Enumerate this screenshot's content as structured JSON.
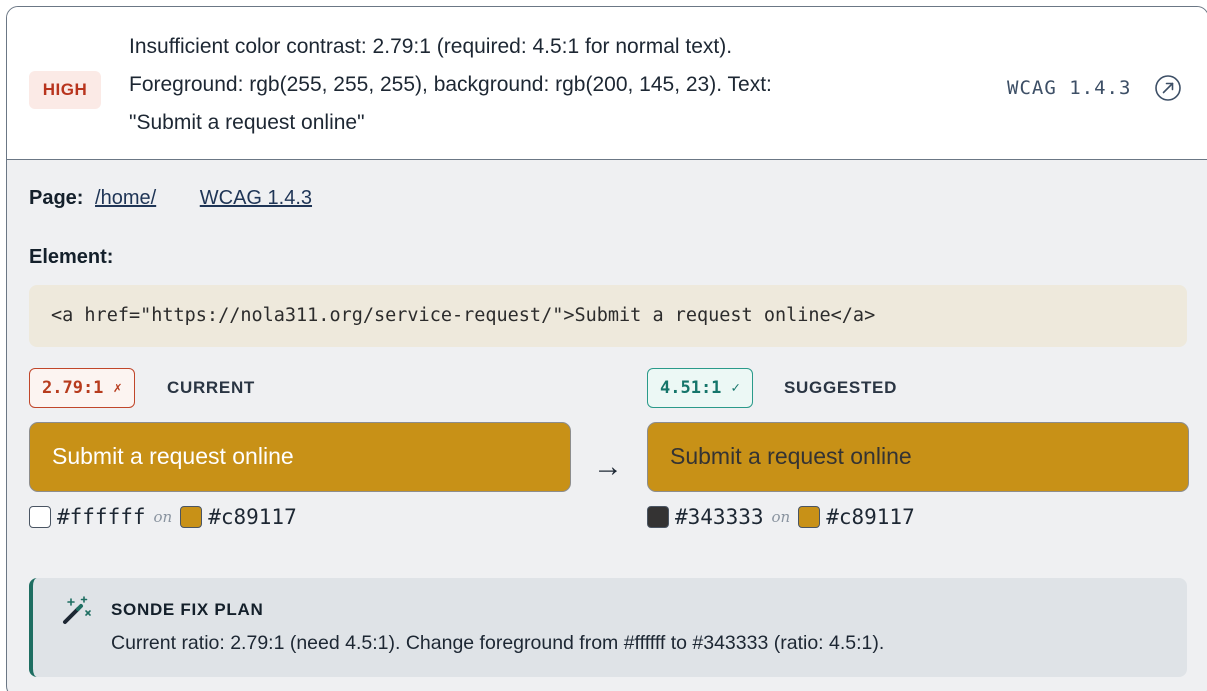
{
  "issue": {
    "severity": "HIGH",
    "message_lines": [
      "Insufficient color contrast: 2.79:1 (required: 4.5:1 for normal text).",
      "Foreground: rgb(255, 255, 255), background: rgb(200, 145, 23). Text:",
      "\"Submit a request online\""
    ],
    "wcag_tag": "WCAG 1.4.3",
    "external_icon": "external-link-icon"
  },
  "details": {
    "page_label": "Page:",
    "page_link": "/home/",
    "wcag_link": "WCAG 1.4.3",
    "element_label": "Element:",
    "element_code": "<a href=\"https://nola311.org/service-request/\">Submit a request online</a>"
  },
  "current": {
    "ratio": "2.79:1",
    "mark": "✗",
    "label": "CURRENT",
    "sample_text": "Submit a request online",
    "fg_hex": "#ffffff",
    "bg_hex": "#c89117",
    "on_word": "on"
  },
  "suggested": {
    "ratio": "4.51:1",
    "mark": "✓",
    "label": "SUGGESTED",
    "sample_text": "Submit a request online",
    "fg_hex": "#343333",
    "bg_hex": "#c89117",
    "on_word": "on"
  },
  "arrow": "→",
  "fix_plan": {
    "icon": "magic-wand-icon",
    "title": "SONDE FIX PLAN",
    "text": "Current ratio: 2.79:1 (need 4.5:1). Change foreground from #ffffff to #343333 (ratio: 4.5:1)."
  },
  "colors": {
    "severity_high": "#b8341d",
    "warning_bg": "#c89117",
    "suggested_fg": "#343333",
    "accent_teal": "#1e6e62"
  }
}
